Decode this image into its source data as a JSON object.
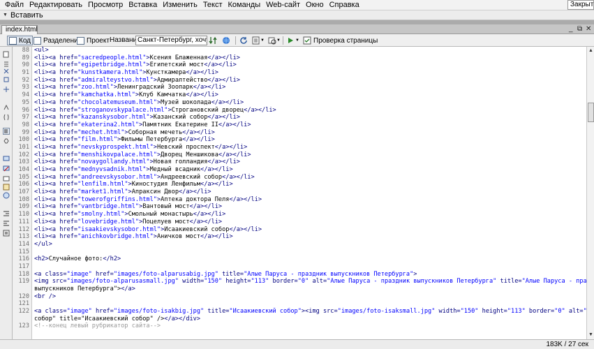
{
  "menu": {
    "items": [
      "Файл",
      "Редактировать",
      "Просмотр",
      "Вставка",
      "Изменить",
      "Текст",
      "Команды",
      "Web-сайт",
      "Окно",
      "Справка"
    ],
    "close_label": "Закрыть"
  },
  "insert_bar": {
    "label": "Вставить"
  },
  "document": {
    "tab_label": "index.html"
  },
  "toolbar": {
    "code_label": "Код",
    "split_label": "Разделение",
    "design_label": "Проект",
    "title_label": "Название:",
    "title_value": "Санкт-Петербург, хочу в Пи",
    "check_page_label": "Проверка страницы"
  },
  "editor": {
    "lines": [
      {
        "n": "88",
        "html": "<ul>"
      },
      {
        "n": "89",
        "html": "<li><a href=\"sacredpeople.html\">Ксения Блаженная</a></li>"
      },
      {
        "n": "90",
        "html": "<li><a href=\"egipetbridge.html\">Египетский мост</a></li>"
      },
      {
        "n": "91",
        "html": "<li><a href=\"kunstkamera.html\">Кунсткамера</a></li>"
      },
      {
        "n": "92",
        "html": "<li><a href=\"admiralteystvo.html\">Адмиралтейство</a></li>"
      },
      {
        "n": "93",
        "html": "<li><a href=\"zoo.html\">Ленинградский Зоопарк</a></li>"
      },
      {
        "n": "94",
        "html": "<li><a href=\"kamchatka.html\">Клуб Камчатка</a></li>"
      },
      {
        "n": "95",
        "html": "<li><a href=\"chocolatemuseum.html\">Музей шоколада</a></li>"
      },
      {
        "n": "96",
        "html": "<li><a href=\"stroganovskypalace.html\">Строгановский дворец</a></li>"
      },
      {
        "n": "97",
        "html": "<li><a href=\"kazanskysobor.html\">Казанский собор</a></li>"
      },
      {
        "n": "98",
        "html": "<li><a href=\"ekaterina2.html\">Памятник Екатерине II</a></li>"
      },
      {
        "n": "99",
        "html": "<li><a href=\"mechet.html\">Соборная мечеть</a></li>"
      },
      {
        "n": "100",
        "html": "<li><a href=\"film.html\">Фильмы Петербурга</a></li>"
      },
      {
        "n": "101",
        "html": "<li><a href=\"nevskyprospekt.html\">Невский проспект</a></li>"
      },
      {
        "n": "102",
        "html": "<li><a href=\"menshikovpalace.html\">Дворец Меншикова</a></li>"
      },
      {
        "n": "103",
        "html": "<li><a href=\"novaygollandy.html\">Новая голландия</a></li>"
      },
      {
        "n": "104",
        "html": "<li><a href=\"mednyvsadnik.html\">Медный всадник</a></li>"
      },
      {
        "n": "105",
        "html": "<li><a href=\"andreevskysobor.html\">Андреевский собор</a></li>"
      },
      {
        "n": "106",
        "html": "<li><a href=\"lenfilm.html\">Киностудия Ленфильм</a></li>"
      },
      {
        "n": "107",
        "html": "<li><a href=\"market1.html\">Апраксин Двор</a></li>"
      },
      {
        "n": "108",
        "html": "<li><a href=\"towerofgriffins.html\">Аптека доктора Пеля</a></li>"
      },
      {
        "n": "109",
        "html": "<li><a href=\"vantbridge.html\">Вантовый мост</a></li>"
      },
      {
        "n": "110",
        "html": "<li><a href=\"smolny.html\">Смольный монастырь</a></li>"
      },
      {
        "n": "111",
        "html": "<li><a href=\"lovebridge.html\">Поцелуев мост</a></li>"
      },
      {
        "n": "112",
        "html": "<li><a href=\"isaakievskysobor.html\">Исаакиевский собор</a></li>"
      },
      {
        "n": "113",
        "html": "<li><a href=\"anichkovbridge.html\">Аничков мост</a></li>"
      },
      {
        "n": "114",
        "html": "</ul>"
      },
      {
        "n": "115",
        "html": ""
      },
      {
        "n": "116",
        "html": "<h2>Случайное фото:</h2>"
      },
      {
        "n": "117",
        "html": ""
      },
      {
        "n": "118",
        "html": "<a class=\"image\" href=\"images/foto-alparusabig.jpg\" title=\"Алые Паруса - праздник выпускников Петербурга\">"
      },
      {
        "n": "119",
        "html": "<img src=\"images/foto-alparusasmall.jpg\" width=\"150\" height=\"113\" border=\"0\" alt=\"Алые Паруса - праздник выпускников Петербурга\" title=\"Алые Паруса - праздник"
      },
      {
        "n": "",
        "html": "выпускников Петербурга\"></a>"
      },
      {
        "n": "120",
        "html": "<br />"
      },
      {
        "n": "121",
        "html": ""
      },
      {
        "n": "122",
        "html": "<a class=\"image\" href=\"images/foto-isakbig.jpg\" title=\"Исаакиевский собор\"><img src=\"images/foto-isaksmall.jpg\" width=\"150\" height=\"113\" border=\"0\" alt=\"Исаакиевский"
      },
      {
        "n": "",
        "html": "собор\" title=\"Исаакиевский собор\" /></a></div>"
      },
      {
        "n": "123",
        "html": "<!--конец левый рубрикатор сайта-->"
      }
    ]
  },
  "statusbar": {
    "text": "183K / 27 сек"
  }
}
